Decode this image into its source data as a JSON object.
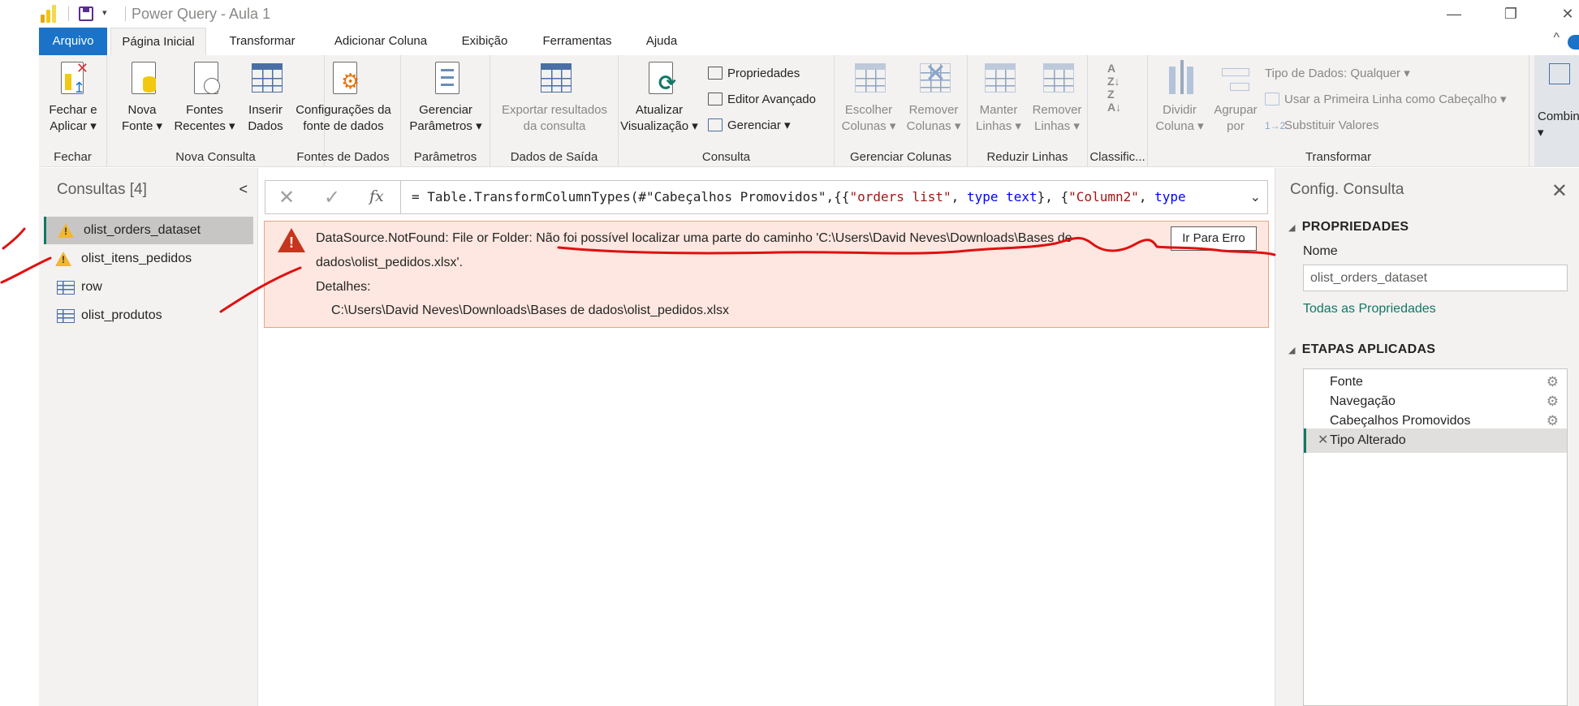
{
  "window": {
    "title": "Power Query - Aula 1",
    "controls": {
      "minimize": "—",
      "restore": "❐",
      "close": "✕"
    },
    "quick_access_dropdown": "▾"
  },
  "menu": {
    "tabs": [
      "Arquivo",
      "Página Inicial",
      "Transformar",
      "Adicionar Coluna",
      "Exibição",
      "Ferramentas",
      "Ajuda"
    ],
    "collapse_glyph": "^"
  },
  "ribbon": {
    "groups": {
      "fechar": {
        "label": "Fechar",
        "close_apply": "Fechar e\nAplicar ▾"
      },
      "nova_consulta": {
        "label": "Nova Consulta",
        "nova_fonte": "Nova\nFonte ▾",
        "fontes_recentes": "Fontes\nRecentes ▾",
        "inserir_dados": "Inserir\nDados"
      },
      "fontes_dados": {
        "label": "Fontes de Dados",
        "config": "Configurações da\nfonte de dados"
      },
      "parametros": {
        "label": "Parâmetros",
        "gerenciar": "Gerenciar\nParâmetros ▾"
      },
      "dados_saida": {
        "label": "Dados de Saída",
        "exportar": "Exportar resultados\nda consulta"
      },
      "consulta": {
        "label": "Consulta",
        "atualizar": "Atualizar\nVisualização ▾",
        "propriedades": "Propriedades",
        "editor": "Editor Avançado",
        "gerenciar": "Gerenciar ▾"
      },
      "gerenciar_colunas": {
        "label": "Gerenciar Colunas",
        "escolher": "Escolher\nColunas ▾",
        "remover": "Remover\nColunas ▾"
      },
      "reduzir_linhas": {
        "label": "Reduzir Linhas",
        "manter": "Manter\nLinhas ▾",
        "remover": "Remover\nLinhas ▾"
      },
      "classificar": {
        "label": "Classific..."
      },
      "transformar": {
        "label": "Transformar",
        "dividir": "Dividir\nColuna ▾",
        "agrupar": "Agrupar\npor",
        "tipo_dados": "Tipo de Dados: Qualquer ▾",
        "primeira_linha": "Usar a Primeira Linha como Cabeçalho ▾",
        "substituir": "Substituir Valores"
      },
      "combinar": {
        "label": "Combin\n▾"
      }
    }
  },
  "queries_pane": {
    "title": "Consultas [4]",
    "collapse_glyph": "<",
    "items": [
      {
        "label": "olist_orders_dataset",
        "icon": "warning-icon"
      },
      {
        "label": "olist_itens_pedidos",
        "icon": "warning-icon"
      },
      {
        "label": "row",
        "icon": "table-icon"
      },
      {
        "label": "olist_produtos",
        "icon": "table-icon"
      }
    ]
  },
  "formula_bar": {
    "cancel": "✕",
    "confirm": "✓",
    "fx": "fx",
    "formula_prefix": "= Table.TransformColumnTypes(#\"Cabeçalhos Promovidos\",{{",
    "s1": "\"orders list\"",
    "c1": ", ",
    "k1": "type text",
    "c2": "}, {",
    "s2": "\"Column2\"",
    "c3": ", ",
    "k2": "type",
    "expand": "⌄"
  },
  "error": {
    "line1_prefix": "DataSource.NotFound: File or Folder: ",
    "line1_message": "Não foi possível localizar uma parte do caminho 'C:\\Users\\David Neves\\Downloads\\Bases de",
    "line2": "dados\\olist_pedidos.xlsx'.",
    "details_label": "Detalhes:",
    "details_path": "C:\\Users\\David Neves\\Downloads\\Bases de dados\\olist_pedidos.xlsx",
    "goto_button": "Ir Para Erro"
  },
  "settings_pane": {
    "title": "Config. Consulta",
    "close": "✕",
    "properties_header": "PROPRIEDADES",
    "name_label": "Nome",
    "name_value": "olist_orders_dataset",
    "all_properties_link": "Todas as Propriedades",
    "steps_header": "ETAPAS APLICADAS",
    "steps": [
      {
        "label": "Fonte",
        "gear": "⚙"
      },
      {
        "label": "Navegação",
        "gear": "⚙"
      },
      {
        "label": "Cabeçalhos Promovidos",
        "gear": "⚙"
      },
      {
        "label": "Tipo Alterado",
        "delete": "✕"
      }
    ]
  },
  "colors": {
    "accent": "#1a73c8",
    "teal": "#117865",
    "error_bg": "#fde7e0",
    "annotation": "#e01010"
  }
}
